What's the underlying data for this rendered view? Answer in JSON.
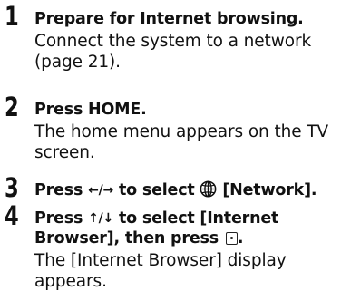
{
  "steps": [
    {
      "number": "1",
      "title": "Prepare for Internet browsing.",
      "desc": "Connect the system to a network (page 21)."
    },
    {
      "number": "2",
      "title": "Press HOME.",
      "desc": "The home menu appears on the TV screen."
    },
    {
      "number": "3",
      "title_pre": "Press",
      "title_arrows": "←/→",
      "title_mid": "to select",
      "title_post": "[Network].",
      "icon": "globe-network-icon"
    },
    {
      "number": "4",
      "title_pre": "Press",
      "title_arrows": "↑/↓",
      "title_post": "to select [Internet Browser], then press",
      "title_end": ".",
      "icon": "enter-button-icon",
      "desc": "The [Internet Browser] display appears."
    }
  ]
}
